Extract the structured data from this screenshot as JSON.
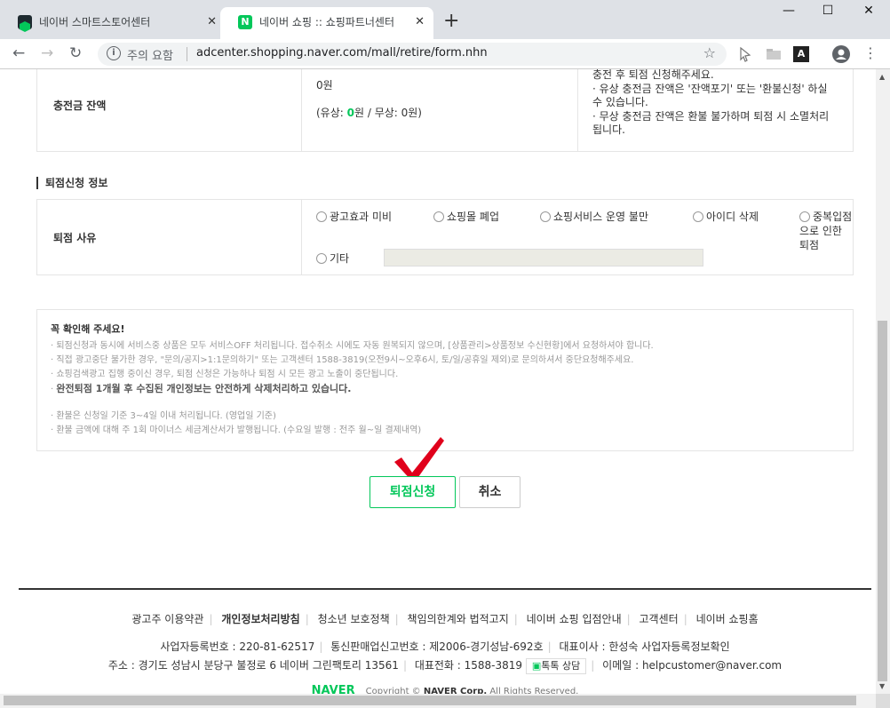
{
  "browser": {
    "tabs": [
      {
        "title": "네이버 스마트스토어센터",
        "active": false
      },
      {
        "title": "네이버 쇼핑 :: 쇼핑파트너센터",
        "active": true
      }
    ],
    "security_label": "주의 요함",
    "url": "adcenter.shopping.naver.com/mall/retire/form.nhn",
    "favicon_letter": "N",
    "ext_letter": "A"
  },
  "balance": {
    "label": "충전금 잔액",
    "amount": "0원",
    "detail_prefix": "(유상: ",
    "paid_amount": "0",
    "detail_suffix": "원 / 무상: 0원)",
    "notes": [
      "충전 후 퇴점 신청해주세요.",
      "· 유상 충전금 잔액은 '잔액포기' 또는 '환불신청' 하실 수 있습니다.",
      "· 무상 충전금 잔액은 환불 불가하며 퇴점 시 소멸처리 됩니다."
    ]
  },
  "section_title": "퇴점신청 정보",
  "reason": {
    "label": "퇴점 사유",
    "options": [
      "광고효과 미비",
      "쇼핑몰 폐업",
      "쇼핑서비스 운영 불만",
      "아이디 삭제",
      "중복입점으로 인한 퇴점"
    ],
    "other_label": "기타"
  },
  "notice": {
    "title": "꼭 확인해 주세요!",
    "items": [
      "퇴점신청과 동시에 서비스중 상품은 모두 서비스OFF 처리됩니다. 접수취소 시에도 자동 원복되지 않으며, [상품관리>상품정보 수신현황]에서 요청하셔야 합니다.",
      "직접 광고중단 불가한 경우, \"문의/공지>1:1문의하기\" 또는 고객센터 1588-3819(오전9시~오후6시, 토/일/공휴일 제외)로 문의하셔서 중단요청해주세요.",
      "쇼핑검색광고 집행 중이신 경우, 퇴점 신청은 가능하나 퇴점 시 모든 광고 노출이 중단됩니다."
    ],
    "strong_item": "완전퇴점 1개월 후 수집된 개인정보는 안전하게 삭제처리하고 있습니다.",
    "items2": [
      "환불은 신청일 기준 3~4일 이내 처리됩니다. (영업일 기준)",
      "환불 금액에 대해 주 1회 마이너스 세금계산서가 발행됩니다. (수요일 발행 : 전주 월~일 결제내역)"
    ]
  },
  "buttons": {
    "submit": "퇴점신청",
    "cancel": "취소"
  },
  "footer": {
    "links": [
      "광고주 이용약관",
      "개인정보처리방침",
      "청소년 보호정책",
      "책임의한계와 법적고지",
      "네이버 쇼핑 입점안내",
      "고객센터",
      "네이버 쇼핑홈"
    ],
    "line1": [
      "사업자등록번호 : 220-81-62517",
      "통신판매업신고번호 : 제2006-경기성남-692호",
      "대표이사 : 한성숙 사업자등록정보확인"
    ],
    "address": "주소 : 경기도 성남시 분당구 불정로 6 네이버 그린팩토리 13561",
    "phone": "대표전화 : 1588-3819",
    "talk": "톡톡 상담",
    "email": "이메일 : helpcustomer@naver.com",
    "logo": "NAVER",
    "copyright_prefix": "Copyright © ",
    "copyright_company": "NAVER Corp.",
    "copyright_suffix": " All Rights Reserved."
  },
  "colors": {
    "accent_green": "#03c75a",
    "check_red": "#e0001b"
  }
}
